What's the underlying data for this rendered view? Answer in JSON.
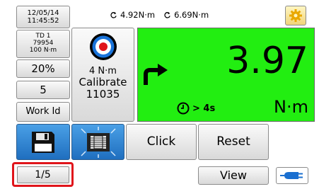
{
  "status": {
    "date": "12/05/14",
    "time": "11:45:52"
  },
  "tool": {
    "id": "TD 1",
    "serial": "79954",
    "capacity": "100 N·m"
  },
  "left_panel": {
    "percent": "20%",
    "count": "5",
    "work_id_label": "Work Id"
  },
  "peaks": {
    "peak1": "4.92N·m",
    "peak2": "6.69N·m"
  },
  "calibrate": {
    "torque": "4 N·m",
    "label": "Calibrate",
    "number": "11035"
  },
  "reading": {
    "value": "3.97",
    "unit": "N·m",
    "timer": "> 4s",
    "background_color": "#22ee11",
    "direction": "clockwise"
  },
  "buttons": {
    "click": "Click",
    "reset": "Reset",
    "view": "View"
  },
  "pager": {
    "page": "1/5",
    "highlight_color": "#e0151b"
  },
  "icons": {
    "settings": "gear-icon",
    "save": "floppy-disk-icon",
    "tool": "torque-tool-icon",
    "target": "target-icon",
    "connection": "usb-plug-icon"
  }
}
